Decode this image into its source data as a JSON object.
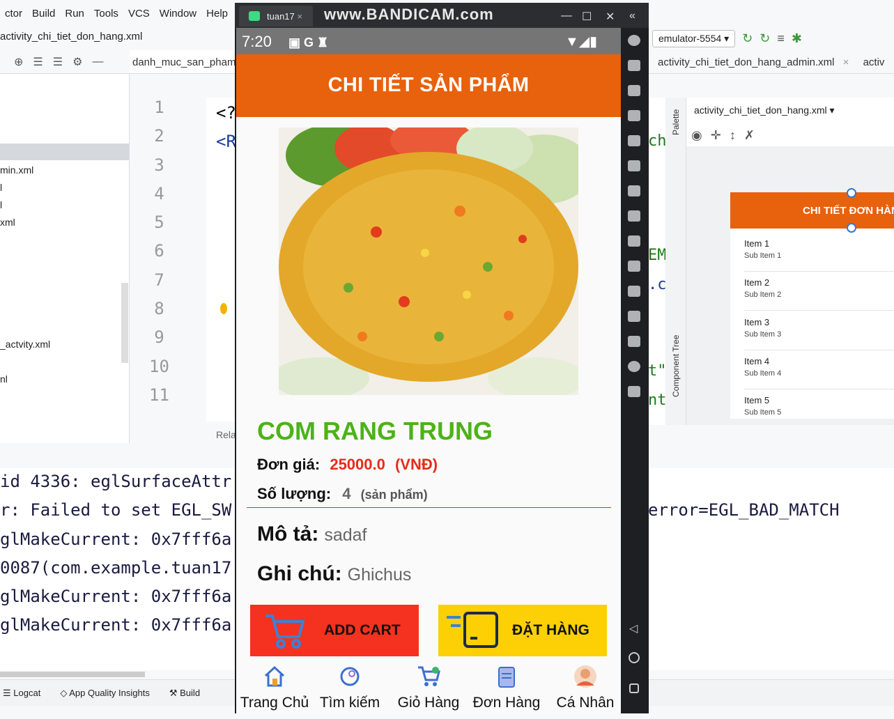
{
  "ide": {
    "menu": [
      "ctor",
      "Build",
      "Run",
      "Tools",
      "VCS",
      "Window",
      "Help"
    ],
    "file_tab": "activity_chi_tiet_don_hang.xml",
    "editor_tab": "danh_muc_san_pham.x",
    "project_files": [
      "min.xml",
      "l",
      "l",
      "xml",
      "_actvity.xml",
      "nl"
    ],
    "line_numbers": [
      "1",
      "2",
      "3",
      "4",
      "5",
      "6",
      "7",
      "8",
      "9",
      "10",
      "11"
    ],
    "code_fragments": [
      "<?",
      "<R"
    ],
    "rela_label": "Rela",
    "log_lines": [
      "id 4336: eglSurfaceAttr",
      "r: Failed to set EGL_SW",
      "glMakeCurrent: 0x7fff6a",
      "0087(com.example.tuan17",
      "glMakeCurrent: 0x7fff6a",
      "glMakeCurrent: 0x7fff6a"
    ],
    "log_right": "error=EGL_BAD_MATCH",
    "right_code": [
      "ch",
      "EM",
      ".c",
      "t\"",
      "nt"
    ],
    "emulator_select": "emulator-5554",
    "right_tab_1": "activity_chi_tiet_don_hang_admin.xml",
    "right_tab_2": "activ",
    "design_file": "activity_chi_tiet_don_hang.xml",
    "palette_label": "Palette",
    "component_tree_label": "Component Tree",
    "preview_title": "CHI TIẾT ĐƠN HÀN",
    "preview_items": [
      {
        "title": "Item 1",
        "sub": "Sub Item 1"
      },
      {
        "title": "Item 2",
        "sub": "Sub Item 2"
      },
      {
        "title": "Item 3",
        "sub": "Sub Item 3"
      },
      {
        "title": "Item 4",
        "sub": "Sub Item 4"
      },
      {
        "title": "Item 5",
        "sub": "Sub Item 5"
      }
    ],
    "bottom_tools": [
      "Logcat",
      "App Quality Insights",
      "Build"
    ]
  },
  "emulator": {
    "tab_label": "tuan17",
    "watermark": "www.BANDICAM.com"
  },
  "phone": {
    "time": "7:20",
    "title": "CHI TIẾT SẢN PHẨM",
    "product_name": "COM RANG TRUNG",
    "price_label": "Đơn giá:",
    "price_value": "25000.0",
    "price_unit": "(VNĐ)",
    "qty_label": "Số lượng:",
    "qty_value": "4",
    "qty_unit": "(sản phẩm)",
    "desc_label": "Mô tả:",
    "desc_value": "sadaf",
    "note_label": "Ghi chú:",
    "note_value": "Ghichus",
    "add_cart_label": "ADD CART",
    "order_label": "ĐẶT HÀNG",
    "nav": [
      "Trang Chủ",
      "Tìm kiếm",
      "Giỏ Hàng",
      "Đơn Hàng",
      "Cá Nhân"
    ],
    "colors": {
      "appbar": "#e8610c",
      "name": "#4cb317",
      "price": "#e82b1a",
      "cart": "#f5311f",
      "order": "#fcd005"
    }
  }
}
